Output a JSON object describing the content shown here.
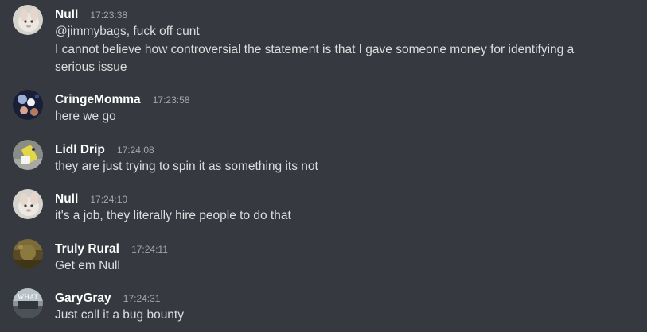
{
  "messages": [
    {
      "username": "Null",
      "timestamp": "17:23:38",
      "avatar": "null-avatar",
      "lines": [
        "@jimmybags, fuck off cunt",
        "I cannot believe how controversial the statement is that I gave someone money for identifying a",
        "serious issue"
      ]
    },
    {
      "username": "CringeMomma",
      "timestamp": "17:23:58",
      "avatar": "cringemomma-avatar",
      "lines": [
        "here we go"
      ]
    },
    {
      "username": "Lidl Drip",
      "timestamp": "17:24:08",
      "avatar": "lidl-drip-avatar",
      "lines": [
        "they are just trying to spin it as something its not"
      ]
    },
    {
      "username": "Null",
      "timestamp": "17:24:10",
      "avatar": "null-avatar",
      "lines": [
        "it's a job, they literally hire people to do that"
      ]
    },
    {
      "username": "Truly Rural",
      "timestamp": "17:24:11",
      "avatar": "truly-rural-avatar",
      "lines": [
        "Get em Null"
      ]
    },
    {
      "username": "GaryGray",
      "timestamp": "17:24:31",
      "avatar": "garygray-avatar",
      "avatar_text": "WHAT",
      "lines": [
        "Just call it a bug bounty"
      ]
    }
  ],
  "colors": {
    "background": "#36393f",
    "username": "#ffffff",
    "timestamp": "#a3a6aa",
    "text": "#dcddde"
  }
}
